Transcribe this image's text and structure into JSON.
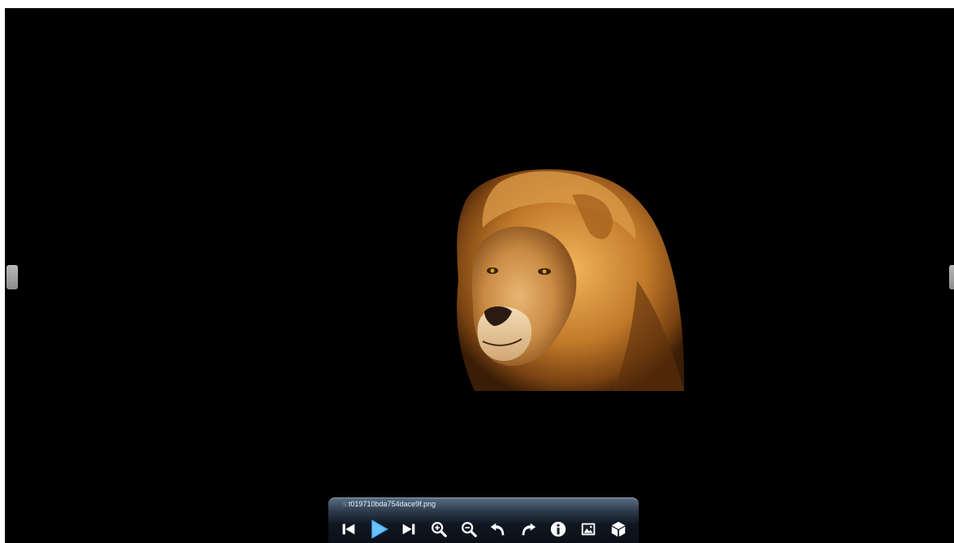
{
  "viewer": {
    "filename_prefix": "s:",
    "filename": "t019710bda754dace9f.png"
  },
  "toolbar": {
    "buttons": [
      {
        "icon": "skip-previous-icon",
        "label": "previous"
      },
      {
        "icon": "play-icon",
        "label": "play"
      },
      {
        "icon": "skip-next-icon",
        "label": "next"
      },
      {
        "icon": "zoom-in-icon",
        "label": "zoom in"
      },
      {
        "icon": "zoom-out-icon",
        "label": "zoom out"
      },
      {
        "icon": "rotate-left-icon",
        "label": "rotate left"
      },
      {
        "icon": "rotate-right-icon",
        "label": "rotate right"
      },
      {
        "icon": "info-icon",
        "label": "info"
      },
      {
        "icon": "picture-icon",
        "label": "picture"
      },
      {
        "icon": "3d-cube-icon",
        "label": "3D"
      }
    ]
  },
  "colors": {
    "background": "#000000",
    "toolbar_top": "#5a6f86",
    "toolbar_bottom": "#0b1017",
    "icon": "#ffffff",
    "play_accent": "#3fa9f5"
  }
}
